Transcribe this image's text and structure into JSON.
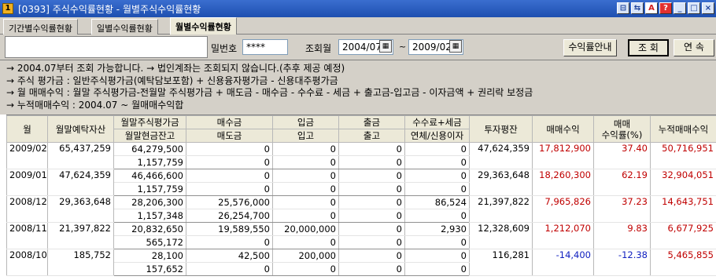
{
  "window": {
    "icon_text": "1",
    "title": "[0393] 주식수익률현황 - 월별주식수익률현황",
    "buttons": [
      "⊟",
      "⇆",
      "A",
      "?",
      "_",
      "□",
      "×"
    ]
  },
  "tabs": [
    {
      "label": "기간별수익률현황"
    },
    {
      "label": "일별수익률현황"
    },
    {
      "label": "월별수익률현황"
    }
  ],
  "controls": {
    "password_label": "밀번호",
    "password_value": "****",
    "period_label": "조회월",
    "from_month": "2004/07",
    "tilde": "~",
    "to_month": "2009/02",
    "calendar_glyph": "▦",
    "guide_button": "수익률안내",
    "query_button": "조 회",
    "next_button": "연 속"
  },
  "notes": [
    "→ 2004.07부터 조회 가능합니다. → 법인계좌는 조회되지 않습니다.(추후 제공 예정)",
    "→ 주식  평가금 : 일반주식평가금(예탁담보포함) + 신용융자평가금 - 신용대주평가금",
    "→ 월  매매수익 : 월말 주식평가금-전월말 주식평가금 + 매도금 - 매수금 - 수수료 - 세금 + 출고금-입고금 - 이자금액 + 권리락 보정금",
    "→ 누적매매수익 : 2004.07 ~ 월매매수익합"
  ],
  "table": {
    "headers_top": [
      "월",
      "월말예탁자산",
      "월말주식평가금",
      "매수금",
      "입금",
      "출금",
      "수수료+세금",
      "투자평잔",
      "매매수익",
      "매매\n수익률(%)",
      "누적매매수익"
    ],
    "headers_bottom": [
      "월말현금잔고",
      "매도금",
      "입고",
      "출고",
      "연체/신용이자"
    ],
    "rows": [
      {
        "month": "2009/02",
        "deposit": "65,437,259",
        "stock_eval": "64,279,500",
        "cash": "1,157,759",
        "buy": "0",
        "sell": "0",
        "in": "0",
        "in2": "0",
        "out": "0",
        "out2": "0",
        "fee": "0",
        "interest": "0",
        "invest_avg": "47,624,359",
        "profit": "17,812,900",
        "rate": "37.40",
        "cum": "50,716,951",
        "sign": "red"
      },
      {
        "month": "2009/01",
        "deposit": "47,624,359",
        "stock_eval": "46,466,600",
        "cash": "1,157,759",
        "buy": "0",
        "sell": "0",
        "in": "0",
        "in2": "0",
        "out": "0",
        "out2": "0",
        "fee": "0",
        "interest": "0",
        "invest_avg": "29,363,648",
        "profit": "18,260,300",
        "rate": "62.19",
        "cum": "32,904,051",
        "sign": "red"
      },
      {
        "month": "2008/12",
        "deposit": "29,363,648",
        "stock_eval": "28,206,300",
        "cash": "1,157,348",
        "buy": "25,576,000",
        "sell": "26,254,700",
        "in": "0",
        "in2": "0",
        "out": "0",
        "out2": "0",
        "fee": "86,524",
        "interest": "0",
        "invest_avg": "21,397,822",
        "profit": "7,965,826",
        "rate": "37.23",
        "cum": "14,643,751",
        "sign": "red"
      },
      {
        "month": "2008/11",
        "deposit": "21,397,822",
        "stock_eval": "20,832,650",
        "cash": "565,172",
        "buy": "19,589,550",
        "sell": "0",
        "in": "20,000,000",
        "in2": "0",
        "out": "0",
        "out2": "0",
        "fee": "2,930",
        "interest": "0",
        "invest_avg": "12,328,609",
        "profit": "1,212,070",
        "rate": "9.83",
        "cum": "6,677,925",
        "sign": "red"
      },
      {
        "month": "2008/10",
        "deposit": "185,752",
        "stock_eval": "28,100",
        "cash": "157,652",
        "buy": "42,500",
        "sell": "0",
        "in": "200,000",
        "in2": "0",
        "out": "0",
        "out2": "0",
        "fee": "0",
        "interest": "0",
        "invest_avg": "116,281",
        "profit": "-14,400",
        "rate": "-12.38",
        "cum": "5,465,855",
        "sign": "blue"
      }
    ]
  },
  "colors": {
    "positive": "#c00000",
    "negative": "#1020c0",
    "titlebar": "#2a5cc0"
  }
}
